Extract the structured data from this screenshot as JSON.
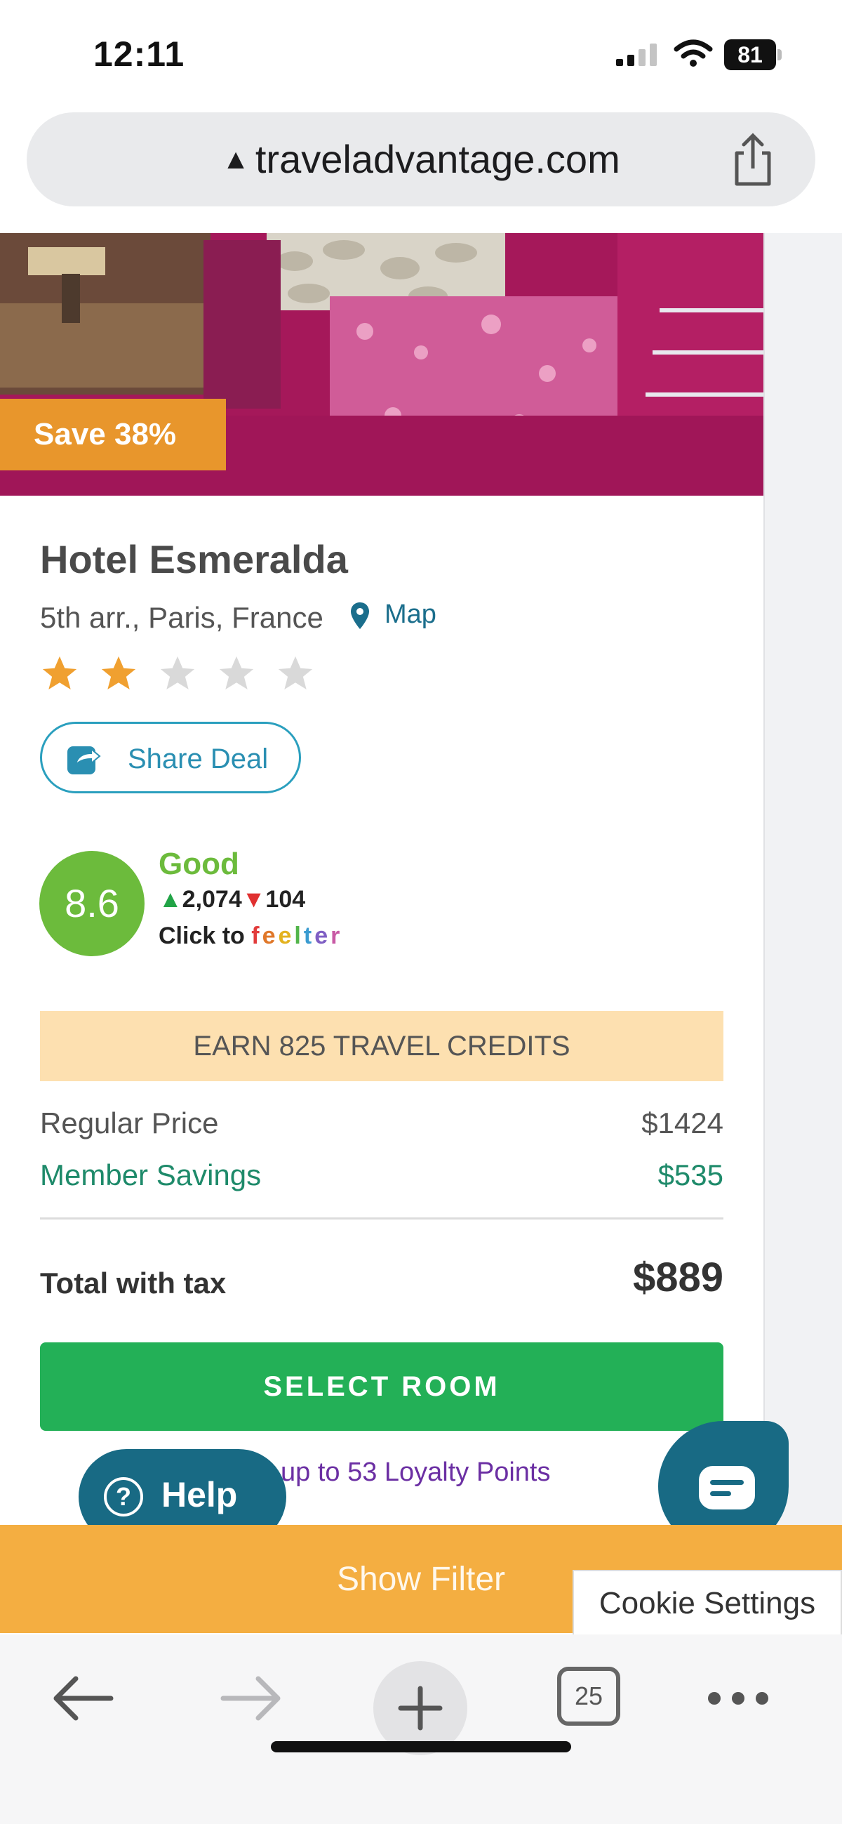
{
  "status_bar": {
    "time": "12:11",
    "battery": "81"
  },
  "browser": {
    "url": "traveladvantage.com",
    "tab_count": "25"
  },
  "deal": {
    "save_badge": "Save 38%",
    "hotel_name": "Hotel Esmeralda",
    "location": "5th arr., Paris, France",
    "map_label": "Map",
    "stars": {
      "filled": 2,
      "total": 5
    },
    "share_label": "Share Deal"
  },
  "rating": {
    "score": "8.6",
    "word": "Good",
    "up_votes": "2,074",
    "down_votes": "104",
    "click_to": "Click to ",
    "feelter_letters": [
      "f",
      "e",
      "e",
      "l",
      "t",
      "e",
      "r"
    ]
  },
  "pricing": {
    "credits_banner": "EARN 825 TRAVEL CREDITS",
    "regular_label": "Regular Price",
    "regular_value": "$1424",
    "savings_label": "Member Savings",
    "savings_value": "$535",
    "total_label": "Total with tax",
    "total_value": "$889",
    "select_button": "SELECT ROOM",
    "loyalty_text": "up to 53 Loyalty Points"
  },
  "overlays": {
    "help_label": "Help",
    "filter_label": "Show Filter",
    "cookie_label": "Cookie Settings"
  },
  "colors": {
    "accent_green": "#23b057",
    "score_green": "#6cbb3c",
    "teal": "#186a84",
    "orange": "#f4ae41",
    "star_filled": "#f0a030",
    "star_empty": "#d9d9d9"
  }
}
